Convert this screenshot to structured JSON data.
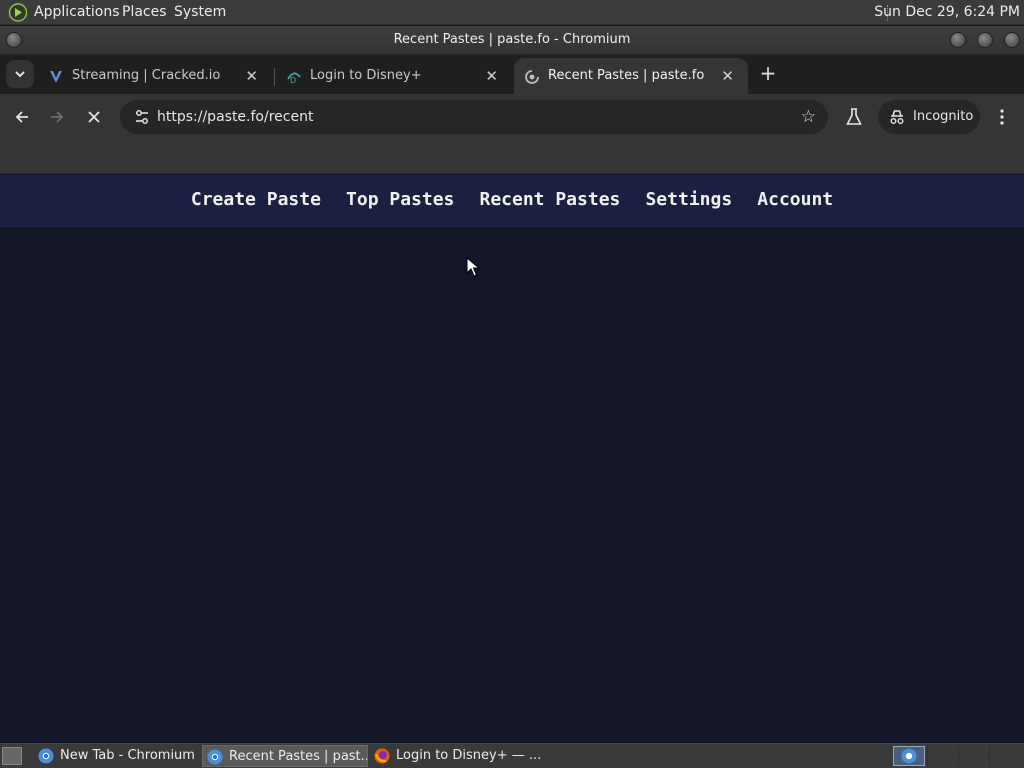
{
  "system_panel": {
    "menus": [
      "Applications",
      "Places",
      "System"
    ],
    "clock": "Sun Dec 29,  6:24 PM"
  },
  "window": {
    "title": "Recent Pastes | paste.fo - Chromium"
  },
  "tabs": [
    {
      "label": "Streaming | Cracked.io",
      "icon": "cracked-favicon",
      "active": false
    },
    {
      "label": "Login to Disney+",
      "icon": "disney-favicon",
      "active": false
    },
    {
      "label": "Recent Pastes | paste.fo",
      "icon": "paste-favicon",
      "active": true
    }
  ],
  "toolbar": {
    "url": "https://paste.fo/recent",
    "incognito_label": "Incognito",
    "loading": true
  },
  "site": {
    "nav": [
      "Create Paste",
      "Top Pastes",
      "Recent Pastes",
      "Settings",
      "Account"
    ],
    "nav_color": "#f2f2f2",
    "background": "#131628",
    "navbar_background": "#1c2040"
  },
  "taskbar": {
    "items": [
      {
        "label": "New Tab - Chromium",
        "icon": "chromium-icon",
        "active": false
      },
      {
        "label": "Recent Pastes | past...",
        "icon": "chromium-icon",
        "active": true
      },
      {
        "label": "Login to Disney+ — ...",
        "icon": "firefox-icon",
        "active": false
      }
    ]
  }
}
